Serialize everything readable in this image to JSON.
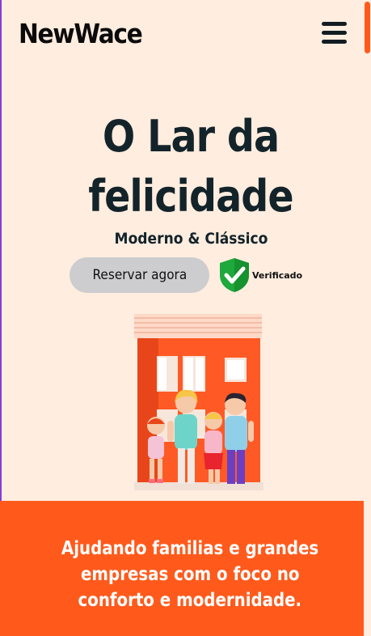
{
  "header": {
    "logo_text": "NewWace",
    "menu_icon": "hamburger-icon"
  },
  "hero": {
    "title_line1": "O Lar da",
    "title_line2": "felicidade",
    "subtitle": "Moderno & Clássico",
    "book_button_label": "Reservar agora",
    "verified_label": "Verificado",
    "verified_icon": "shield-check-icon"
  },
  "banner": {
    "line1": "Ajudando familias e grandes",
    "line2": "empresas com o foco no",
    "line3": "conforto e modernidade."
  },
  "colors": {
    "background": "#ffeddf",
    "accent": "#ff5a1c",
    "text_dark": "#13232a",
    "button_bg": "#cdcccf",
    "verified_green": "#1fa83c"
  }
}
